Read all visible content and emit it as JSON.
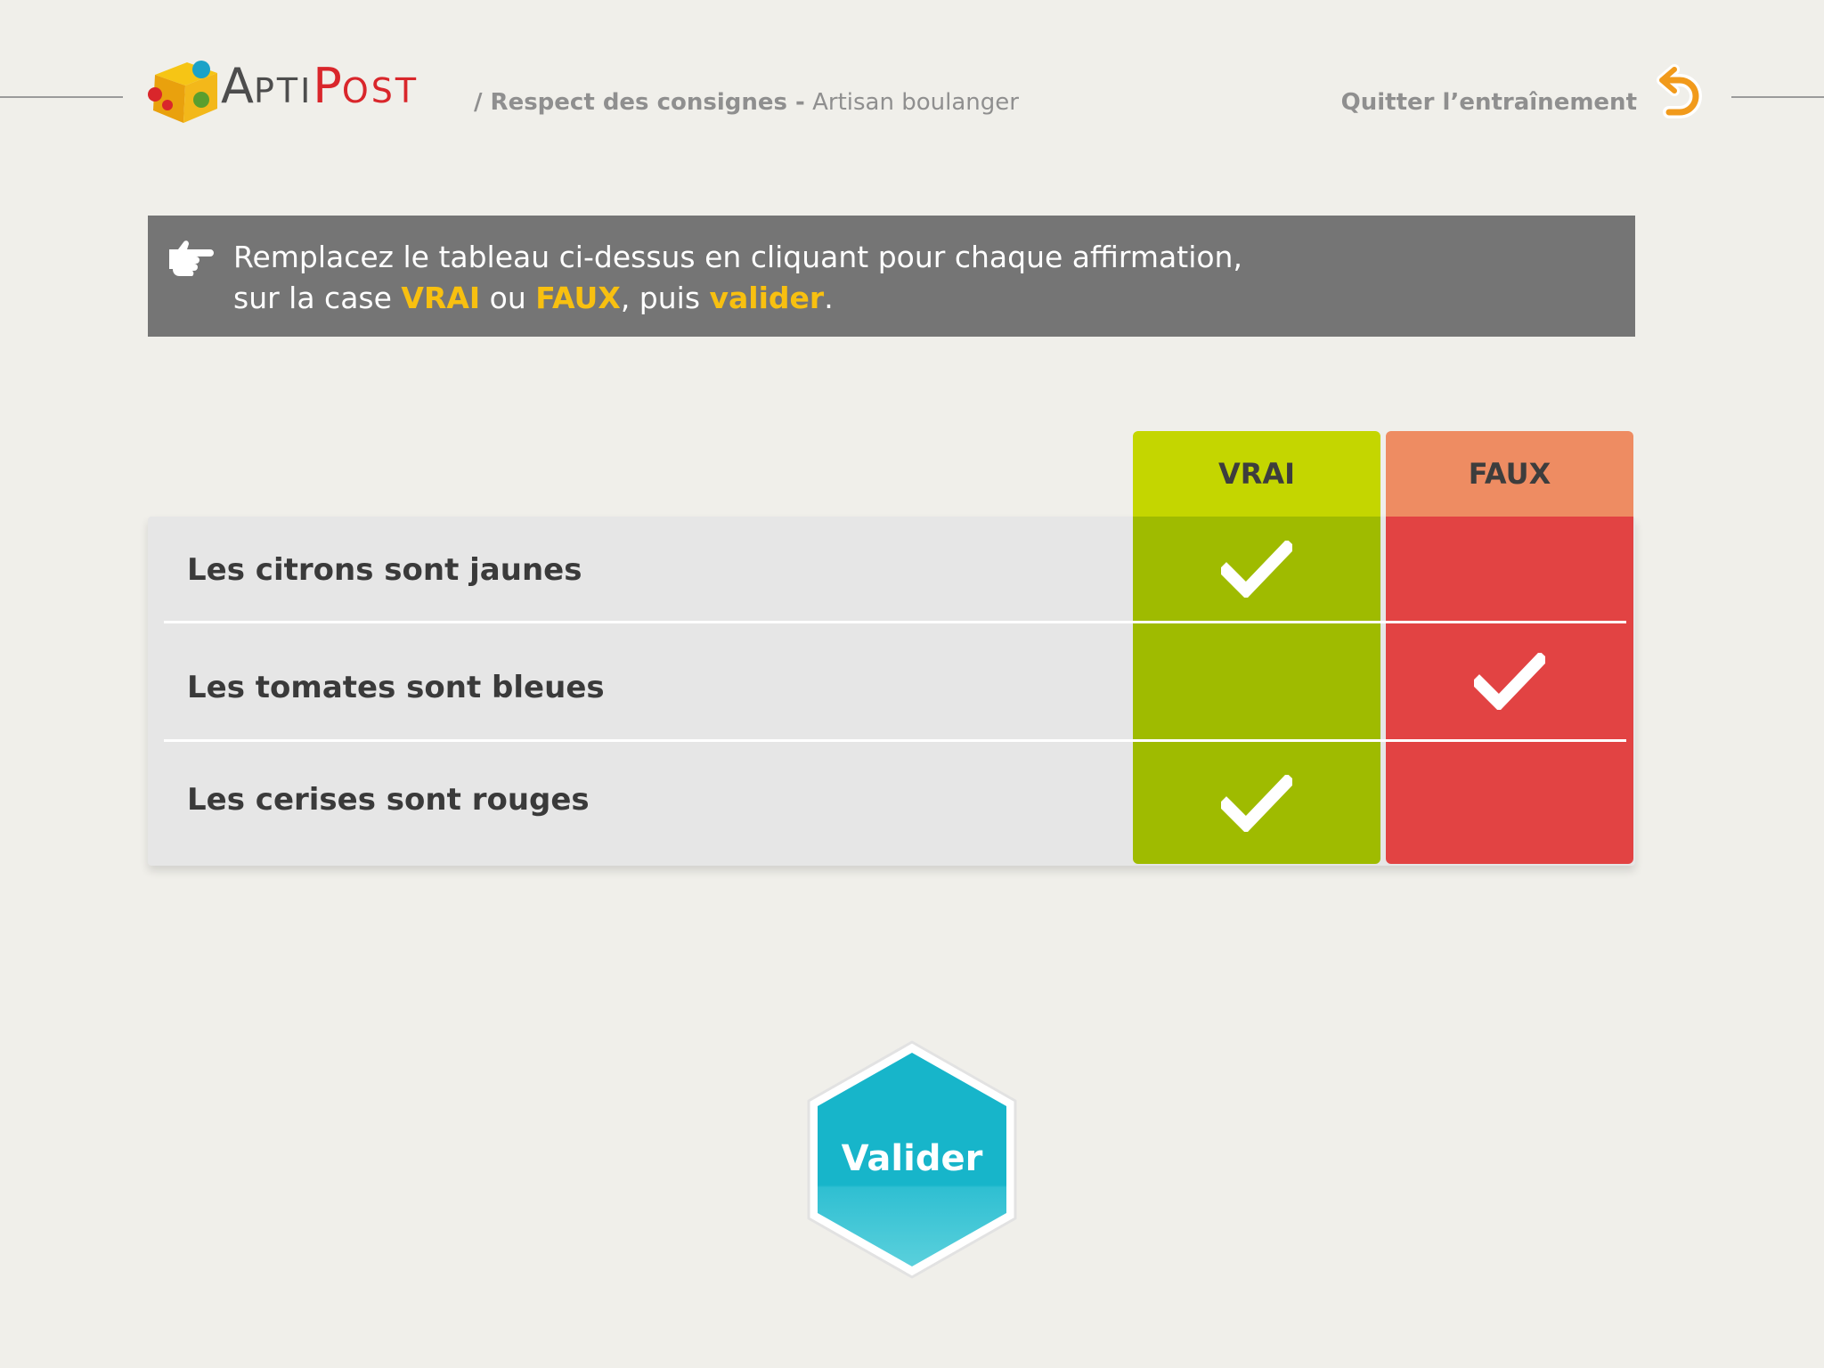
{
  "header": {
    "logo": {
      "apti": "APTI",
      "post": "POST"
    },
    "breadcrumb": {
      "prefix": "/ Respect des consignes -",
      "job": "Artisan boulanger"
    },
    "quit_label": "Quitter l’entraînement"
  },
  "instructions": {
    "line1": "Remplacez le tableau ci-dessus en cliquant pour chaque affirmation,",
    "line2_a": "sur la case ",
    "line2_vrai": "VRAI",
    "line2_b": " ou ",
    "line2_faux": "FAUX",
    "line2_c": ", puis ",
    "line2_valider": "valider",
    "line2_d": "."
  },
  "table": {
    "columns": [
      "VRAI",
      "FAUX"
    ],
    "rows": [
      {
        "label": "Les citrons sont jaunes",
        "answer": "VRAI"
      },
      {
        "label": "Les tomates sont bleues",
        "answer": "FAUX"
      },
      {
        "label": "Les cerises sont rouges",
        "answer": "VRAI"
      }
    ]
  },
  "submit_label": "Valider",
  "colors": {
    "background": "#f0efea",
    "vrai_header": "#c4d600",
    "vrai_body": "#9fbb00",
    "faux_header": "#ee8c62",
    "faux_body": "#e24343",
    "highlight": "#f8c010",
    "button": "#17b5ca"
  }
}
